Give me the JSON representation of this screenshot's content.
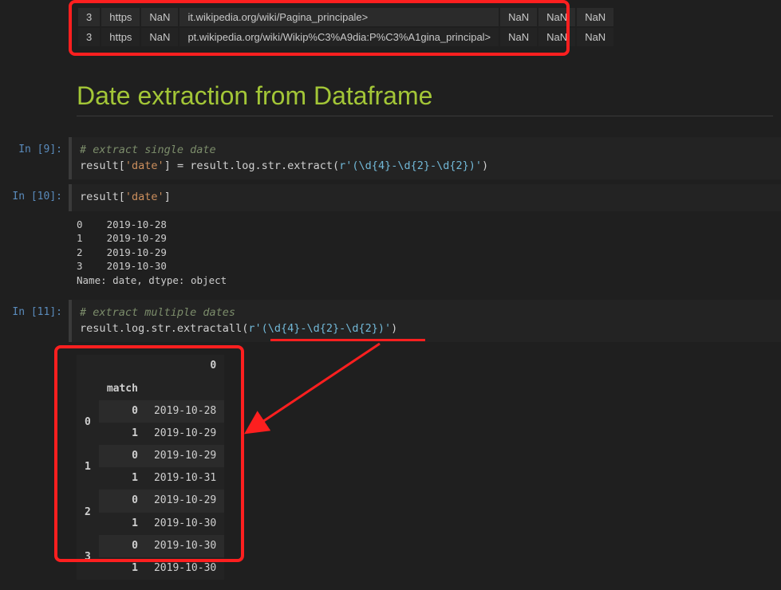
{
  "top_table": {
    "rows": [
      {
        "idx": "3",
        "c0": "https",
        "c1": "NaN",
        "c2": "it.wikipedia.org/wiki/Pagina_principale>",
        "c3": "NaN",
        "c4": "NaN",
        "c5": "NaN"
      },
      {
        "idx": "3",
        "c0": "https",
        "c1": "NaN",
        "c2": "pt.wikipedia.org/wiki/Wikip%C3%A9dia:P%C3%A1gina_principal>",
        "c3": "NaN",
        "c4": "NaN",
        "c5": "NaN"
      }
    ]
  },
  "heading": "Date extraction from Dataframe",
  "cell9": {
    "prompt": "In [9]:",
    "comment": "# extract single date",
    "code_plain_1": "result[",
    "code_str_1": "'date'",
    "code_plain_2": "] ",
    "code_op": "=",
    "code_plain_3": " result.log.str.extract(",
    "code_raw": "r'(\\d{4}-\\d{2}-\\d{2})'",
    "code_plain_4": ")"
  },
  "cell10": {
    "prompt": "In [10]:",
    "code_plain_1": "result[",
    "code_str_1": "'date'",
    "code_plain_2": "]",
    "output": "0    2019-10-28\n1    2019-10-29\n2    2019-10-29\n3    2019-10-30\nName: date, dtype: object"
  },
  "cell11": {
    "prompt": "In [11]:",
    "comment": "# extract multiple dates",
    "code_plain_1": "result.log.str.extractall(",
    "code_raw": "r'(\\d{4}-\\d{2}-\\d{2})'",
    "code_plain_2": ")"
  },
  "chart_data": {
    "type": "table",
    "title": "extractall result",
    "columns": [
      "",
      "match",
      "0"
    ],
    "rows": [
      {
        "group": "0",
        "match": "0",
        "val": "2019-10-28"
      },
      {
        "group": "0",
        "match": "1",
        "val": "2019-10-29"
      },
      {
        "group": "1",
        "match": "0",
        "val": "2019-10-29"
      },
      {
        "group": "1",
        "match": "1",
        "val": "2019-10-31"
      },
      {
        "group": "2",
        "match": "0",
        "val": "2019-10-29"
      },
      {
        "group": "2",
        "match": "1",
        "val": "2019-10-30"
      },
      {
        "group": "3",
        "match": "0",
        "val": "2019-10-30"
      },
      {
        "group": "3",
        "match": "1",
        "val": "2019-10-30"
      }
    ]
  }
}
